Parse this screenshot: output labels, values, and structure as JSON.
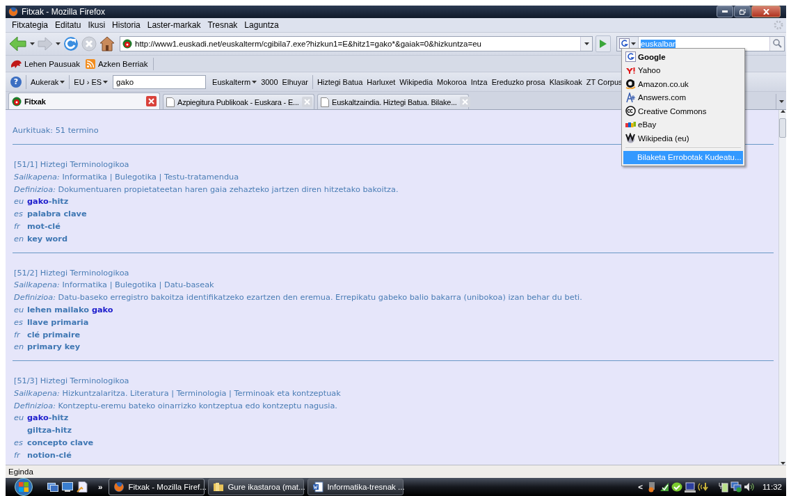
{
  "window": {
    "title": "Fitxak - Mozilla Firefox"
  },
  "menu": [
    "Fitxategia",
    "Editatu",
    "Ikusi",
    "Historia",
    "Laster-markak",
    "Tresnak",
    "Laguntza"
  ],
  "address": {
    "url": "http://www1.euskadi.net/euskalterm/cgibila7.exe?hizkun1=E&hitz1=gako*&gaiak=0&hizkuntza=eu"
  },
  "search": {
    "value": "euskalbar"
  },
  "bookmarks": [
    {
      "label": "Lehen Pausuak",
      "kind": "site"
    },
    {
      "label": "Azken Berriak",
      "kind": "feed"
    }
  ],
  "euskalbar": {
    "help": "?",
    "options": "Aukerak",
    "languages": "EU › ES",
    "query": "gako",
    "links": [
      {
        "label": "Euskalterm",
        "kind": "menu"
      },
      {
        "label": "3000",
        "kind": "link"
      },
      {
        "label": "Elhuyar",
        "kind": "link"
      },
      {
        "kind": "separator"
      },
      {
        "label": "Hiztegi Batua",
        "kind": "link"
      },
      {
        "label": "Harluxet",
        "kind": "link"
      },
      {
        "label": "Wikipedia",
        "kind": "link"
      },
      {
        "label": "Mokoroa",
        "kind": "link"
      },
      {
        "label": "Intza",
        "kind": "link"
      },
      {
        "label": "Ereduzko prosa",
        "kind": "link"
      },
      {
        "label": "Klasikoak",
        "kind": "link"
      },
      {
        "label": "ZT Corpus",
        "kind": "link"
      }
    ]
  },
  "tabs": [
    {
      "label": "Fitxak",
      "selected": true
    },
    {
      "label": "Azpiegitura Publikoak - Euskara - E...",
      "selected": false
    },
    {
      "label": "Euskaltzaindia. Hiztegi Batua. Bilake...",
      "selected": false
    }
  ],
  "content": {
    "count": "Aurkituak: 51 termino",
    "entries": [
      {
        "header": "[51/1] Hiztegi Terminologikoa",
        "classification_label": "Sailkapena:",
        "classification": "Informatika | Bulegotika | Testu-tratamendua",
        "definition_label": "Definizioa:",
        "definition": "Dokumentuaren propietateetan haren gaia zehazteko jartzen diren hitzetako bakoitza.",
        "terms": [
          {
            "lang": "eu",
            "parts": [
              {
                "text": "gako",
                "match": true
              },
              {
                "text": "-hitz",
                "match": false
              }
            ]
          },
          {
            "lang": "es",
            "parts": [
              {
                "text": "palabra clave",
                "match": false
              }
            ]
          },
          {
            "lang": "fr",
            "parts": [
              {
                "text": "mot-clé",
                "match": false
              }
            ]
          },
          {
            "lang": "en",
            "parts": [
              {
                "text": "key word",
                "match": false
              }
            ]
          }
        ]
      },
      {
        "header": "[51/2] Hiztegi Terminologikoa",
        "classification_label": "Sailkapena:",
        "classification": "Informatika | Bulegotika | Datu-baseak",
        "definition_label": "Definizioa:",
        "definition": "Datu-baseko erregistro bakoitza identifikatzeko ezartzen den eremua. Errepikatu gabeko balio bakarra (unibokoa) izan behar du beti.",
        "terms": [
          {
            "lang": "eu",
            "parts": [
              {
                "text": "lehen mailako ",
                "match": false
              },
              {
                "text": "gako",
                "match": true
              }
            ]
          },
          {
            "lang": "es",
            "parts": [
              {
                "text": "llave primaria",
                "match": false
              }
            ]
          },
          {
            "lang": "fr",
            "parts": [
              {
                "text": "clé primaire",
                "match": false
              }
            ]
          },
          {
            "lang": "en",
            "parts": [
              {
                "text": "primary key",
                "match": false
              }
            ]
          }
        ]
      },
      {
        "header": "[51/3] Hiztegi Terminologikoa",
        "classification_label": "Sailkapena:",
        "classification": "Hizkuntzalaritza. Literatura | Terminologia | Terminoak eta kontzeptuak",
        "definition_label": "Definizioa:",
        "definition": "Kontzeptu-eremu bateko oinarrizko kontzeptua edo kontzeptu nagusia.",
        "terms": [
          {
            "lang": "eu",
            "parts": [
              {
                "text": "gako",
                "match": true
              },
              {
                "text": "-hitz",
                "match": false
              }
            ]
          },
          {
            "parts": [
              {
                "text": "giltza-hitz",
                "match": false
              }
            ]
          },
          {
            "lang": "es",
            "parts": [
              {
                "text": "concepto clave",
                "match": false
              }
            ]
          },
          {
            "lang": "fr",
            "parts": [
              {
                "text": "notion-clé",
                "match": false
              }
            ]
          }
        ]
      }
    ]
  },
  "status_bar": {
    "text": "Eginda"
  },
  "search_engines": {
    "engines": [
      {
        "label": "Google",
        "selected": true
      },
      {
        "label": "Yahoo",
        "selected": false
      },
      {
        "label": "Amazon.co.uk",
        "selected": false
      },
      {
        "label": "Answers.com",
        "selected": false
      },
      {
        "label": "Creative Commons",
        "selected": false
      },
      {
        "label": "eBay",
        "selected": false
      },
      {
        "label": "Wikipedia (eu)",
        "selected": false
      }
    ],
    "manage": {
      "label": "Bilaketa Errobotak Kudeatu...",
      "highlighted": true
    }
  },
  "taskbar": {
    "overflow": "»",
    "buttons": [
      {
        "label": "Fitxak - Mozilla Firef...",
        "selected": true
      },
      {
        "label": "Gure ikastaroa (mat...",
        "selected": false
      },
      {
        "label": "Informatika-tresnak ...",
        "selected": false
      }
    ],
    "tray_toggle": "<",
    "clock": "11:32"
  }
}
